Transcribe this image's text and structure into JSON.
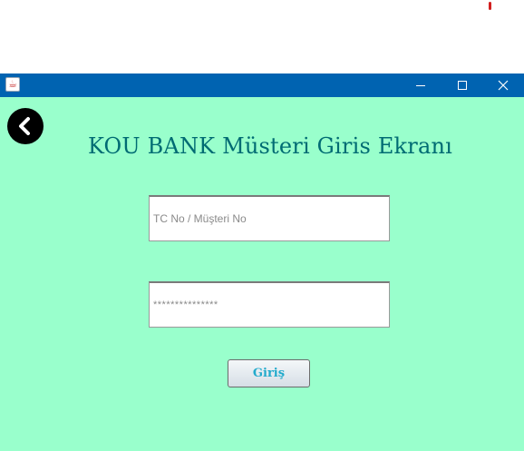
{
  "window": {
    "app_icon": "java-icon"
  },
  "colors": {
    "titlebar": "#0063b1",
    "background": "#99ffcc",
    "title_text": "#006b73",
    "button_text": "#22aacc"
  },
  "header": {
    "back_icon": "chevron-left-icon",
    "title": "KOU BANK Müsteri Giris Ekranı"
  },
  "form": {
    "user_placeholder": "TC No / Müşteri No",
    "user_value": "",
    "password_value": "***************",
    "submit_label": "Giriş"
  }
}
